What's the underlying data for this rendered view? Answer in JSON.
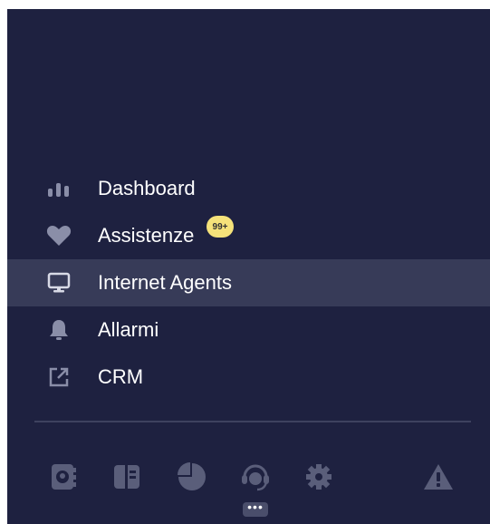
{
  "colors": {
    "panel_bg": "#1e2140",
    "active_bg": "#373b58",
    "icon": "#8a8ea8",
    "badge": "#f5e27a"
  },
  "nav": {
    "items": [
      {
        "label": "Dashboard",
        "icon": "bar-chart-icon",
        "active": false
      },
      {
        "label": "Assistenze",
        "icon": "heart-icon",
        "active": false,
        "badge": "99+"
      },
      {
        "label": "Internet Agents",
        "icon": "monitor-icon",
        "active": true
      },
      {
        "label": "Allarmi",
        "icon": "bell-icon",
        "active": false
      },
      {
        "label": "CRM",
        "icon": "external-link-icon",
        "active": false
      }
    ]
  },
  "toolbar": {
    "icons": [
      "contact-book-icon",
      "book-icon",
      "pie-chart-icon",
      "headset-agent-icon",
      "gear-icon",
      "warning-icon"
    ],
    "more_label": "•••"
  }
}
